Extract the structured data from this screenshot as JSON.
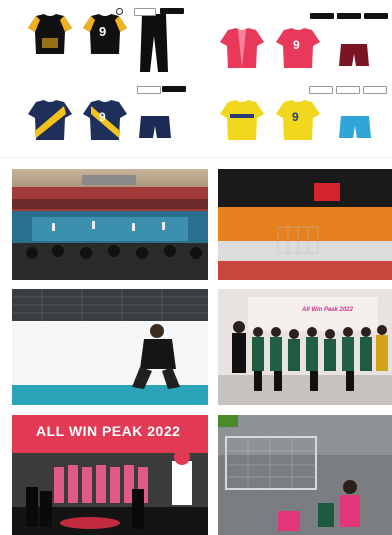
{
  "kits": [
    {
      "id": "kit-black-yellow",
      "label": "",
      "jersey_number": "9",
      "sponsors": [
        "",
        "",
        ""
      ],
      "colors": {
        "main": "#111111",
        "accent": "#f0b21c",
        "shorts": "#0e0e0e"
      }
    },
    {
      "id": "kit-pink",
      "label": "",
      "jersey_number": "9",
      "sponsors": [
        "",
        "",
        ""
      ],
      "colors": {
        "main": "#e8395a",
        "accent": "#f7a3b5",
        "shorts": "#7a1624"
      }
    },
    {
      "id": "kit-navy-yellow",
      "label": "",
      "jersey_number": "9",
      "sponsors": [
        "",
        ""
      ],
      "colors": {
        "main": "#1e2f5c",
        "accent": "#f5c21b",
        "shorts": "#1c2a55"
      }
    },
    {
      "id": "kit-yellow",
      "label": "",
      "jersey_number": "9",
      "sponsors": [
        "",
        "",
        ""
      ],
      "colors": {
        "main": "#f1d71d",
        "accent": "#2b3a7a",
        "shorts": "#2fa6d8"
      }
    }
  ],
  "photos": {
    "arena_banner_text": "",
    "handball_banner_text": "",
    "floor_sign_left": "",
    "floor_sign_right": "",
    "backdrop_text": "All Win Peak 2022",
    "ceremony_banner": "ALL WIN PEAK 2022",
    "broadcast_corner": "",
    "broadcast_caption_line1": "",
    "broadcast_caption_line2": ""
  }
}
